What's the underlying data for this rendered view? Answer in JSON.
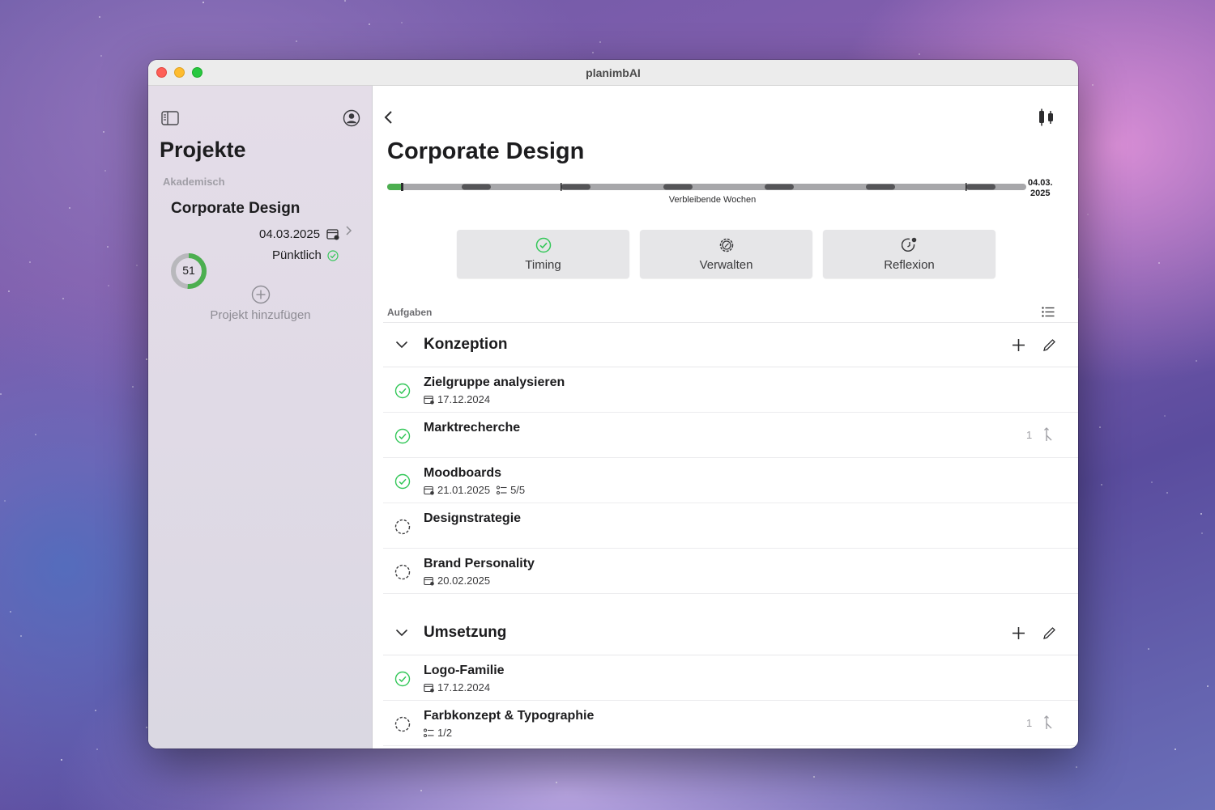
{
  "window": {
    "title": "planimbAI"
  },
  "sidebar": {
    "title": "Projekte",
    "group_label": "Akademisch",
    "project": {
      "name": "Corporate Design",
      "progress_value": "51",
      "progress_fraction": 0.51,
      "date": "04.03.2025",
      "status": "Pünktlich"
    },
    "add_project_label": "Projekt hinzufügen"
  },
  "main": {
    "title": "Corporate Design",
    "timeline": {
      "end_date_line1": "04.03.",
      "end_date_line2": "2025",
      "label": "Verbleibende Wochen"
    },
    "actions": [
      {
        "label": "Timing",
        "icon": "check-circle-icon"
      },
      {
        "label": "Verwalten",
        "icon": "gear-icon"
      },
      {
        "label": "Reflexion",
        "icon": "clock-badge-icon"
      }
    ],
    "section_label": "Aufgaben",
    "groups": [
      {
        "name": "Konzeption",
        "tasks": [
          {
            "name": "Zielgruppe analysieren",
            "done": true,
            "date": "17.12.2024",
            "subtasks": "",
            "count": ""
          },
          {
            "name": "Marktrecherche",
            "done": true,
            "date": "",
            "subtasks": "",
            "count": "1"
          },
          {
            "name": "Moodboards",
            "done": true,
            "date": "21.01.2025",
            "subtasks": "5/5",
            "count": ""
          },
          {
            "name": "Designstrategie",
            "done": false,
            "date": "",
            "subtasks": "",
            "count": ""
          },
          {
            "name": "Brand Personality",
            "done": false,
            "date": "20.02.2025",
            "subtasks": "",
            "count": ""
          }
        ]
      },
      {
        "name": "Umsetzung",
        "tasks": [
          {
            "name": "Logo-Familie",
            "done": true,
            "date": "17.12.2024",
            "subtasks": "",
            "count": ""
          },
          {
            "name": "Farbkonzept & Typographie",
            "done": false,
            "date": "",
            "subtasks": "1/2",
            "count": "1"
          }
        ]
      }
    ]
  },
  "colors": {
    "accent_green": "#34c759",
    "progress_green": "#4caf50",
    "timeline_track": "#a7a7aa",
    "timeline_segment": "#555558"
  }
}
